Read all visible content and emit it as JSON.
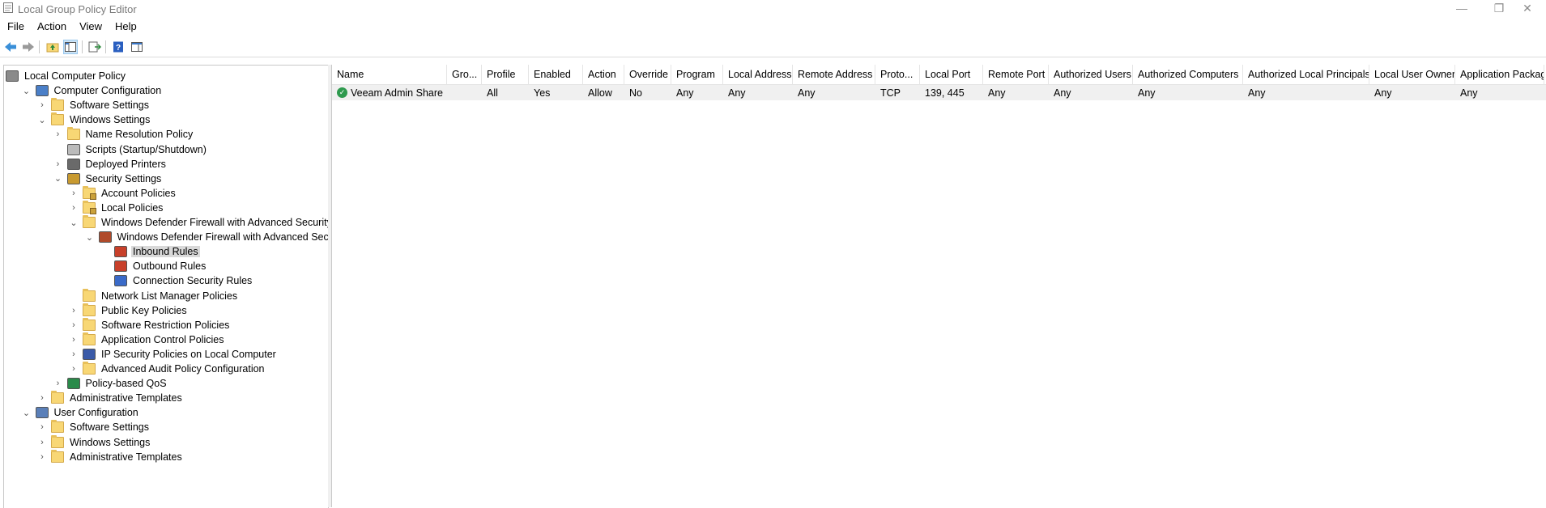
{
  "window": {
    "title": "Local Group Policy Editor",
    "app_icon": "policy-editor-icon",
    "controls": {
      "minimize": "—",
      "restore": "❐",
      "close": "✕"
    }
  },
  "menu": [
    "File",
    "Action",
    "View",
    "Help"
  ],
  "toolbar": {
    "buttons": [
      "back-arrow-icon",
      "forward-arrow-icon",
      "up-folder-icon",
      "show-hide-tree-icon",
      "export-list-icon",
      "help-icon",
      "show-hide-action-pane-icon"
    ]
  },
  "tree": [
    {
      "label": "Local Computer Policy",
      "expander": "",
      "icon": "computer-policy-icon"
    },
    {
      "label": "Computer Configuration",
      "expander": "⌄",
      "icon": "computer-icon"
    },
    {
      "label": "Software Settings",
      "expander": "›",
      "icon": "folder-icon"
    },
    {
      "label": "Windows Settings",
      "expander": "⌄",
      "icon": "folder-icon"
    },
    {
      "label": "Name Resolution Policy",
      "expander": "›",
      "icon": "folder-icon"
    },
    {
      "label": "Scripts (Startup/Shutdown)",
      "expander": "",
      "icon": "script-icon"
    },
    {
      "label": "Deployed Printers",
      "expander": "›",
      "icon": "printer-icon"
    },
    {
      "label": "Security Settings",
      "expander": "⌄",
      "icon": "security-settings-icon"
    },
    {
      "label": "Account Policies",
      "expander": "›",
      "icon": "locked-folder-icon"
    },
    {
      "label": "Local Policies",
      "expander": "›",
      "icon": "locked-folder-icon"
    },
    {
      "label": "Windows Defender Firewall with Advanced Security",
      "expander": "⌄",
      "icon": "folder-icon"
    },
    {
      "label": "Windows Defender Firewall with Advanced Security -",
      "expander": "⌄",
      "icon": "firewall-icon"
    },
    {
      "label": "Inbound Rules",
      "expander": "",
      "icon": "inbound-rules-icon",
      "selected": true
    },
    {
      "label": "Outbound Rules",
      "expander": "",
      "icon": "outbound-rules-icon"
    },
    {
      "label": "Connection Security Rules",
      "expander": "",
      "icon": "connection-security-icon"
    },
    {
      "label": "Network List Manager Policies",
      "expander": "",
      "icon": "folder-icon"
    },
    {
      "label": "Public Key Policies",
      "expander": "›",
      "icon": "folder-icon"
    },
    {
      "label": "Software Restriction Policies",
      "expander": "›",
      "icon": "folder-icon"
    },
    {
      "label": "Application Control Policies",
      "expander": "›",
      "icon": "folder-icon"
    },
    {
      "label": "IP Security Policies on Local Computer",
      "expander": "›",
      "icon": "ip-security-icon"
    },
    {
      "label": "Advanced Audit Policy Configuration",
      "expander": "›",
      "icon": "folder-icon"
    },
    {
      "label": "Policy-based QoS",
      "expander": "›",
      "icon": "qos-chart-icon"
    },
    {
      "label": "Administrative Templates",
      "expander": "›",
      "icon": "folder-icon"
    },
    {
      "label": "User Configuration",
      "expander": "⌄",
      "icon": "user-icon"
    },
    {
      "label": "Software Settings",
      "expander": "›",
      "icon": "folder-icon"
    },
    {
      "label": "Windows Settings",
      "expander": "›",
      "icon": "folder-icon"
    },
    {
      "label": "Administrative Templates",
      "expander": "›",
      "icon": "folder-icon"
    }
  ],
  "table": {
    "columns": [
      "Name",
      "Gro...",
      "Profile",
      "Enabled",
      "Action",
      "Override",
      "Program",
      "Local Address",
      "Remote Address",
      "Proto...",
      "Local Port",
      "Remote Port",
      "Authorized Users",
      "Authorized Computers",
      "Authorized Local Principals",
      "Local User Owner",
      "Application Package"
    ],
    "rows": [
      {
        "icon": "allow-rule-icon",
        "cells": [
          "Veeam Admin Share",
          "",
          "All",
          "Yes",
          "Allow",
          "No",
          "Any",
          "Any",
          "Any",
          "TCP",
          "139, 445",
          "Any",
          "Any",
          "Any",
          "Any",
          "Any",
          "Any"
        ]
      }
    ]
  },
  "colors": {
    "selection": "#d9d9d9",
    "row_highlight": "#f0f0f0",
    "allow_icon": "#2e9a4e",
    "folder": "#f8d775"
  }
}
